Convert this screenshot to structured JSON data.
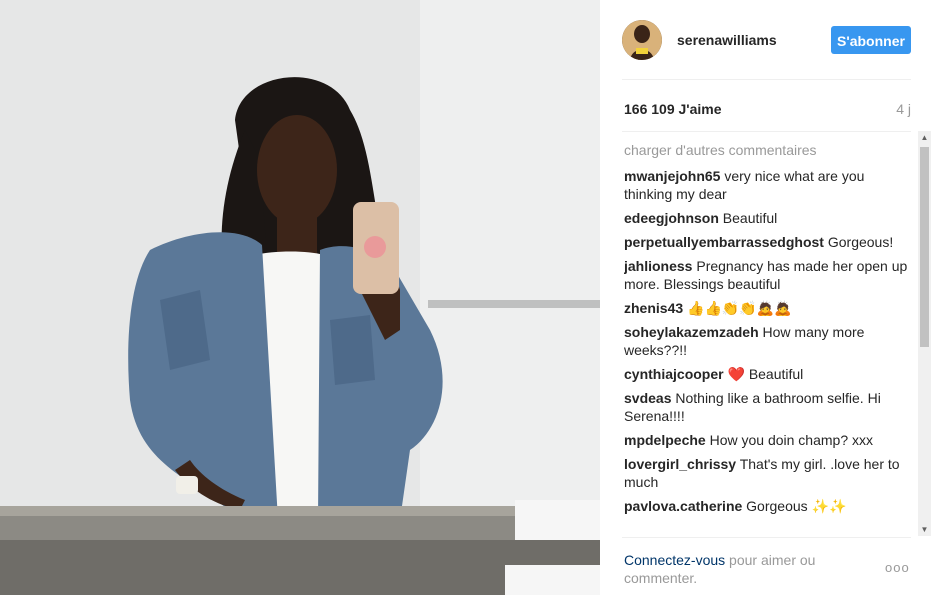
{
  "post": {
    "photo_icon": "mirror-selfie-photo"
  },
  "header": {
    "username": "serenawilliams",
    "follow_label": "S'abonner",
    "accent_color": "#3897f0"
  },
  "stats": {
    "likes": "166 109 J'aime",
    "age": "4 j"
  },
  "comments": {
    "load_more": "charger d'autres commentaires",
    "items": [
      {
        "user": "mwanjejohn65",
        "text": "very nice what are you thinking my dear"
      },
      {
        "user": "edeegjohnson",
        "text": "Beautiful"
      },
      {
        "user": "perpetuallyembarrassedghost",
        "text": "Gorgeous!"
      },
      {
        "user": "jahlioness",
        "text": "Pregnancy has made her open up more. Blessings beautiful"
      },
      {
        "user": "zhenis43",
        "text": "👍👍👏👏🙇🙇"
      },
      {
        "user": "soheylakazemzadeh",
        "text": "How many more weeks??!!"
      },
      {
        "user": "cynthiajcooper",
        "emoji": "❤️",
        "text": "Beautiful"
      },
      {
        "user": "svdeas",
        "text": "Nothing like a bathroom selfie. Hi Serena!!!!"
      },
      {
        "user": "mpdelpeche",
        "text": "How you doin champ? xxx"
      },
      {
        "user": "lovergirl_chrissy",
        "text": "That's my girl. .love her to much"
      },
      {
        "user": "pavlova.catherine",
        "text": "Gorgeous ✨✨"
      }
    ]
  },
  "footer": {
    "login_link": "Connectez-vous",
    "prompt": " pour aimer ou commenter.",
    "more_icon": "more-options-icon",
    "more_label": "ooo"
  }
}
